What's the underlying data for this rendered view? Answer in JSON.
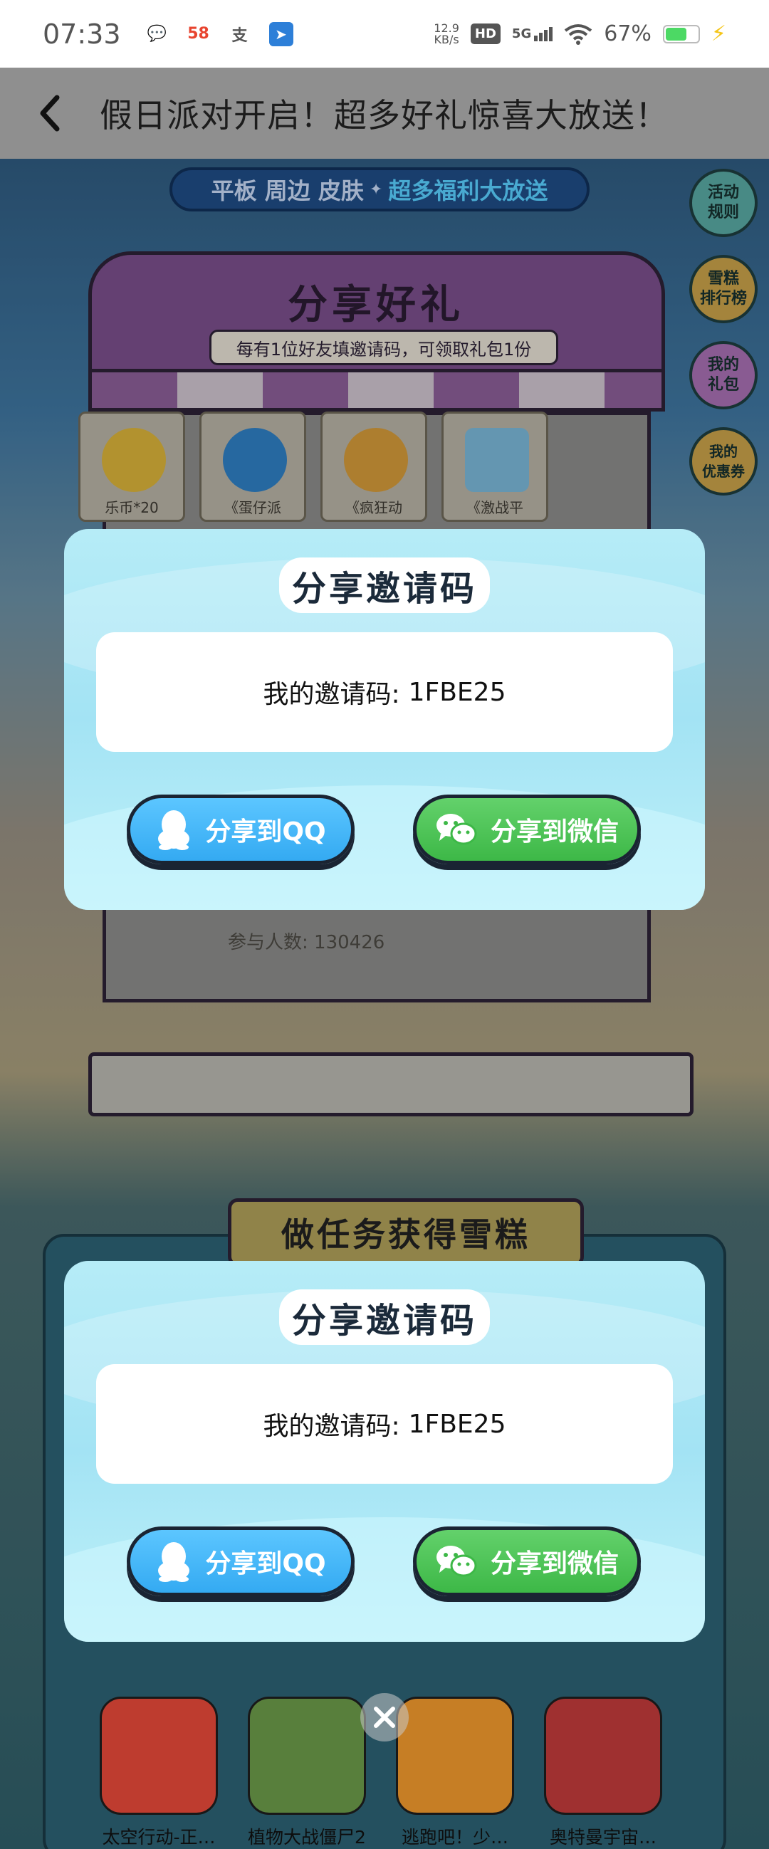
{
  "status_bar": {
    "time": "07:33",
    "apps": [
      {
        "icon": "wechat-icon",
        "glyph": "💬",
        "color": "#555555"
      },
      {
        "icon": "58-app-icon",
        "glyph": "58",
        "color": "#e8442f"
      },
      {
        "icon": "alipay-icon",
        "glyph": "支",
        "color": "#555555"
      },
      {
        "icon": "app-notification-icon",
        "glyph": "➤",
        "color": "#2d7fd8"
      }
    ],
    "network_speed_value": "12.9",
    "network_speed_unit": "KB/s",
    "hd_label": "HD",
    "network_type": "5G",
    "battery_percent": "67%",
    "battery_level": 0.67
  },
  "title_bar": {
    "back_icon": "chevron-left-icon",
    "title": "假日派对开启！超多好礼惊喜大放送！"
  },
  "background": {
    "banner_part1": "平板 周边 皮肤",
    "banner_sep": "✦",
    "banner_part2": "超多福利大放送",
    "side_buttons": [
      {
        "label": "活动\n规则",
        "color": "#58a9a3"
      },
      {
        "label": "雪糕\n排行榜",
        "color": "#c9a24a"
      },
      {
        "label": "我的\n礼包",
        "color": "#a86fb3"
      },
      {
        "label": "我的\n优惠券",
        "color": "#c9a24a"
      }
    ],
    "stall_title": "分享好礼",
    "stall_subtitle": "每有1位好友填邀请码，可领取礼包1份",
    "prizes": [
      {
        "label": "乐币*20",
        "color": "#d9b23a"
      },
      {
        "label": "《蛋仔派",
        "color": "#2f7fc4"
      },
      {
        "label": "《疯狂动",
        "color": "#d39a3a"
      },
      {
        "label": "《激战平",
        "color": "#7ab8d8"
      }
    ],
    "participants": "参与人数: 130426",
    "task_title": "做任务获得雪糕",
    "games": [
      {
        "name": "太空行动-正…",
        "color": "#e84a3a"
      },
      {
        "name": "植物大战僵尸2",
        "color": "#6c9b4a"
      },
      {
        "name": "逃跑吧！少…",
        "color": "#f29a2e"
      },
      {
        "name": "奥特曼宇宙…",
        "color": "#c33b3b"
      }
    ]
  },
  "dialogs": [
    {
      "title": "分享邀请码",
      "code_label": "我的邀请码:",
      "code": "1FBE25",
      "share_qq_label": "分享到QQ",
      "share_wechat_label": "分享到微信"
    },
    {
      "title": "分享邀请码",
      "code_label": "我的邀请码:",
      "code": "1FBE25",
      "share_qq_label": "分享到QQ",
      "share_wechat_label": "分享到微信"
    }
  ],
  "close_icon": "close-icon"
}
